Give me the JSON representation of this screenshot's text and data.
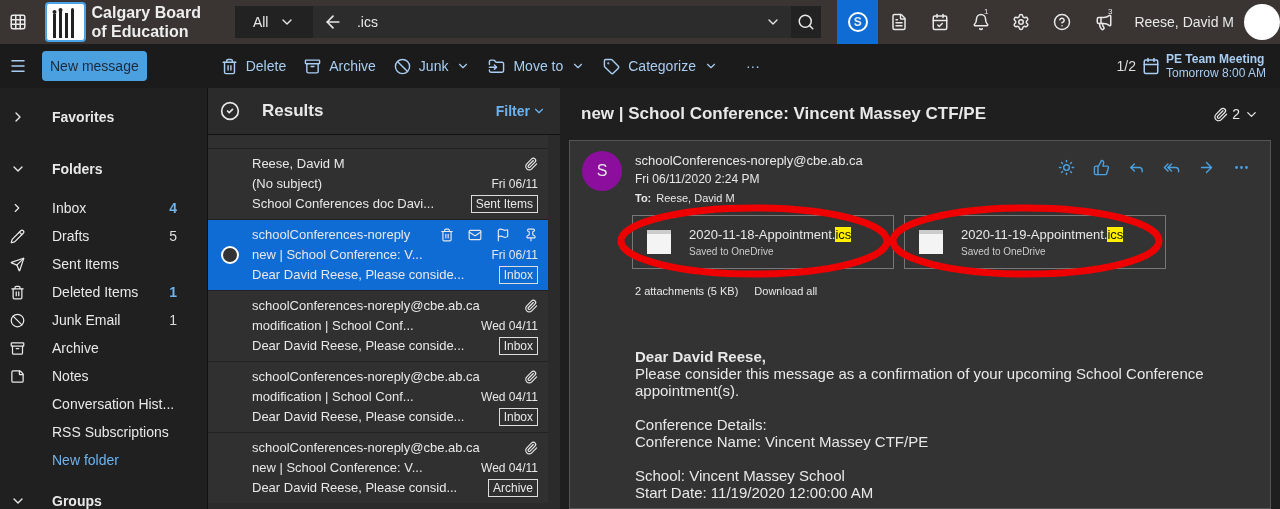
{
  "topbar": {
    "org_line1": "Calgary Board",
    "org_line2": "of Education",
    "scope": "All",
    "search_value": ".ics",
    "skype_letter": "S",
    "user": "Reese, David M",
    "notifications_badge": "1",
    "feedback_badge": "3"
  },
  "toolbar": {
    "new_message": "New message",
    "actions": [
      {
        "kind": "delete",
        "label": "Delete",
        "menu": false
      },
      {
        "kind": "archive",
        "label": "Archive",
        "menu": false
      },
      {
        "kind": "junk",
        "label": "Junk",
        "menu": true
      },
      {
        "kind": "move",
        "label": "Move to",
        "menu": true
      },
      {
        "kind": "categorize",
        "label": "Categorize",
        "menu": true
      }
    ],
    "more": "···",
    "reminder_count": "1/2",
    "reminder_title": "PE Team Meeting",
    "reminder_time": "Tomorrow 8:00 AM"
  },
  "sidebar": {
    "favorites": "Favorites",
    "folders_label": "Folders",
    "folders": [
      {
        "kind": "inbox",
        "name": "Inbox",
        "count": "4",
        "unread": true,
        "expandable": true
      },
      {
        "kind": "drafts",
        "name": "Drafts",
        "count": "5",
        "unread": false,
        "expandable": false
      },
      {
        "kind": "sent",
        "name": "Sent Items",
        "expandable": false
      },
      {
        "kind": "deleted",
        "name": "Deleted Items",
        "count": "1",
        "unread": true,
        "expandable": false
      },
      {
        "kind": "junk",
        "name": "Junk Email",
        "count": "1",
        "unread": false,
        "expandable": false
      },
      {
        "kind": "archive",
        "name": "Archive",
        "expandable": false
      },
      {
        "kind": "notes",
        "name": "Notes",
        "expandable": false
      },
      {
        "kind": "plain",
        "name": "Conversation Hist...",
        "expandable": false
      },
      {
        "kind": "plain",
        "name": "RSS Subscriptions",
        "expandable": false
      }
    ],
    "new_folder": "New folder",
    "groups": "Groups"
  },
  "list": {
    "title": "Results",
    "filter": "Filter",
    "messages": [
      {
        "from": "Reese, David M",
        "subject": "(No subject)",
        "date": "Fri 06/11",
        "preview": "School Conferences doc Davi...",
        "folder": "Sent Items",
        "selected": false,
        "attachment": true
      },
      {
        "from": "schoolConferences-noreply",
        "subject": "new | School Conference: V...",
        "date": "Fri 06/11",
        "preview": "Dear David Reese, Please conside...",
        "folder": "Inbox",
        "selected": true,
        "attachment": false
      },
      {
        "from": "schoolConferences-noreply@cbe.ab.ca",
        "subject": "modification | School Conf...",
        "date": "Wed 04/11",
        "preview": "Dear David Reese, Please conside...",
        "folder": "Inbox",
        "selected": false,
        "attachment": true
      },
      {
        "from": "schoolConferences-noreply@cbe.ab.ca",
        "subject": "modification | School Conf...",
        "date": "Wed 04/11",
        "preview": "Dear David Reese, Please conside...",
        "folder": "Inbox",
        "selected": false,
        "attachment": true
      },
      {
        "from": "schoolConferences-noreply@cbe.ab.ca",
        "subject": "new | School Conference: V...",
        "date": "Wed 04/11",
        "preview": "Dear David Reese, Please consid...",
        "folder": "Archive",
        "selected": false,
        "attachment": true
      }
    ]
  },
  "reading": {
    "subject": "new | School Conference: Vincent Massey CTF/PE",
    "attachment_count": "2",
    "avatar_letter": "S",
    "from": "schoolConferences-noreply@cbe.ab.ca",
    "sent": "Fri 06/11/2020 2:24 PM",
    "to_label": "To:",
    "to": "Reese, David M",
    "attachments": [
      {
        "name": "2020-11-18-Appointment.",
        "match": "ics",
        "status": "Saved to OneDrive",
        "circled": true
      },
      {
        "name": "2020-11-19-Appointment.",
        "match": "ics",
        "status": "Saved to OneDrive",
        "circled": true
      }
    ],
    "attachments_summary": "2 attachments (5 KB)",
    "download_all": "Download all",
    "greeting": "Dear David Reese,",
    "paragraphs": [
      [
        "Please consider this message as a confirmation of your upcoming School Conference appointment(s)."
      ],
      [
        "Conference Details:",
        "Conference Name: Vincent Massey CTF/PE"
      ],
      [
        "School: Vincent Massey School",
        "Start Date: 11/19/2020 12:00:00 AM"
      ]
    ]
  }
}
